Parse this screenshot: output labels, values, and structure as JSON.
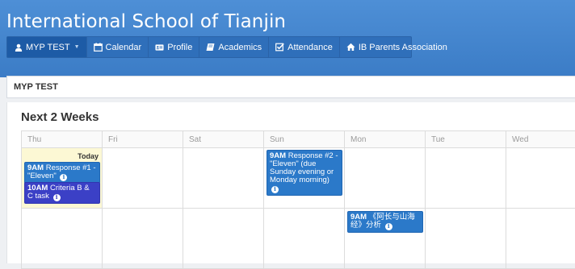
{
  "header": {
    "school_name": "International School of Tianjin"
  },
  "nav": {
    "items": [
      {
        "label": "MYP TEST",
        "icon": "user-icon"
      },
      {
        "label": "Calendar",
        "icon": "calendar-icon"
      },
      {
        "label": "Profile",
        "icon": "id-card-icon"
      },
      {
        "label": "Academics",
        "icon": "book-icon"
      },
      {
        "label": "Attendance",
        "icon": "checkbox-icon"
      },
      {
        "label": "IB Parents Association",
        "icon": "home-icon"
      }
    ]
  },
  "subbar": {
    "title": "MYP TEST"
  },
  "section": {
    "title": "Next 2 Weeks"
  },
  "calendar": {
    "days": [
      "Thu",
      "Fri",
      "Sat",
      "Sun",
      "Mon",
      "Tue",
      "Wed"
    ],
    "today_label": "Today",
    "events": [
      {
        "time": "9AM",
        "title": "Response #1 - \"Eleven\""
      },
      {
        "time": "10AM",
        "title": "Criteria B & C task"
      },
      {
        "time": "9AM",
        "title": "Response #2 - \"Eleven\" (due Sunday evening or Monday morning)"
      },
      {
        "time": "9AM",
        "title": "《阿长与山海经》分析"
      }
    ]
  },
  "colors": {
    "header_blue": "#3b7cc6",
    "event_blue": "#2b79c9",
    "event_purple": "#3b40c6",
    "today_yellow": "#fcf8d4"
  }
}
